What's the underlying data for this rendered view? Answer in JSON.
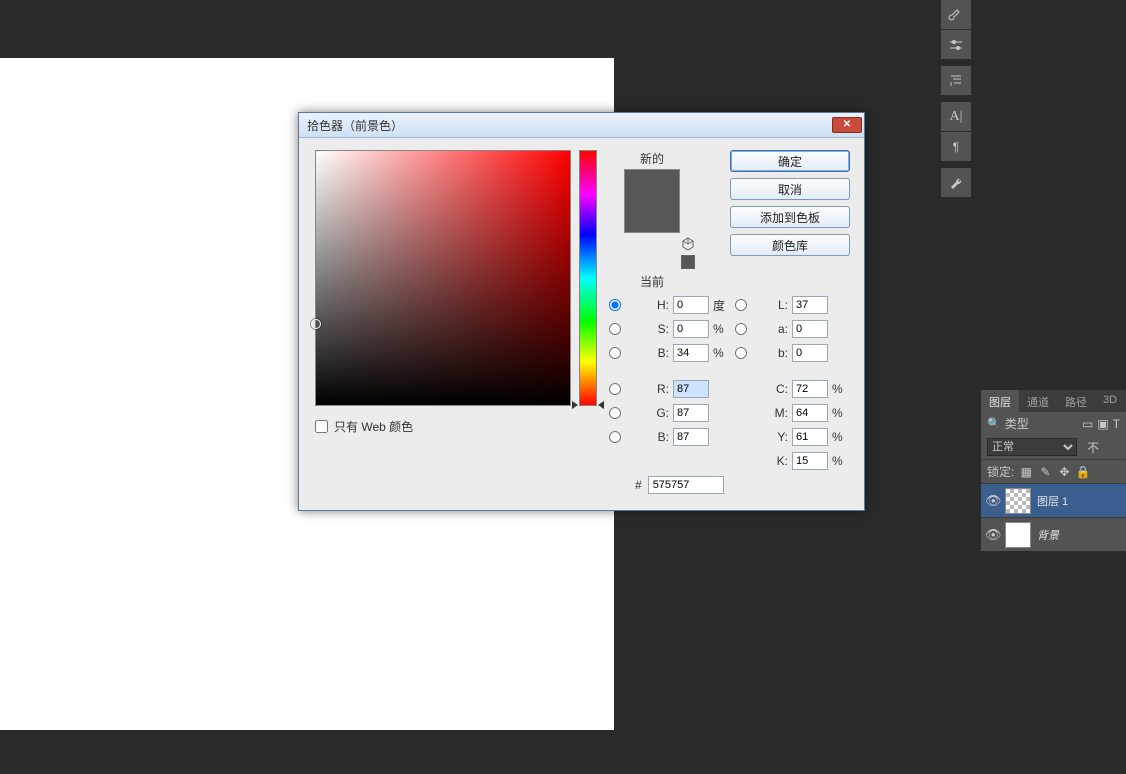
{
  "dialog": {
    "title": "拾色器（前景色）",
    "new_label": "新的",
    "current_label": "当前",
    "new_color": "#575757",
    "current_color": "#575757",
    "web_only_label": "只有 Web 颜色",
    "buttons": {
      "ok": "确定",
      "cancel": "取消",
      "add_swatch": "添加到色板",
      "libraries": "颜色库"
    },
    "hsb": {
      "h_label": "H:",
      "h_value": "0",
      "h_unit": "度",
      "s_label": "S:",
      "s_value": "0",
      "s_unit": "%",
      "b_label": "B:",
      "b_value": "34",
      "b_unit": "%"
    },
    "rgb": {
      "r_label": "R:",
      "r_value": "87",
      "g_label": "G:",
      "g_value": "87",
      "b_label": "B:",
      "b_value": "87"
    },
    "lab": {
      "l_label": "L:",
      "l_value": "37",
      "a_label": "a:",
      "a_value": "0",
      "b_label": "b:",
      "b_value": "0"
    },
    "cmyk": {
      "c_label": "C:",
      "c_value": "72",
      "unit": "%",
      "m_label": "M:",
      "m_value": "64",
      "y_label": "Y:",
      "y_value": "61",
      "k_label": "K:",
      "k_value": "15"
    },
    "hex_label": "#",
    "hex_value": "575757"
  },
  "panels": {
    "tabs": {
      "layers": "图层",
      "channels": "通道",
      "paths": "路径",
      "threed": "3D"
    },
    "filter_label": "类型",
    "blend_mode": "正常",
    "opacity_label": "不",
    "lock_label": "锁定:",
    "layer1_name": "图层 1",
    "background_name": "背景"
  },
  "toolbar_icons": {
    "brush": "brush-tool",
    "settings": "sliders-tool",
    "char": "character-tool",
    "align_a": "type-a-tool",
    "paragraph": "paragraph-tool",
    "wrench": "wrench-tool"
  }
}
